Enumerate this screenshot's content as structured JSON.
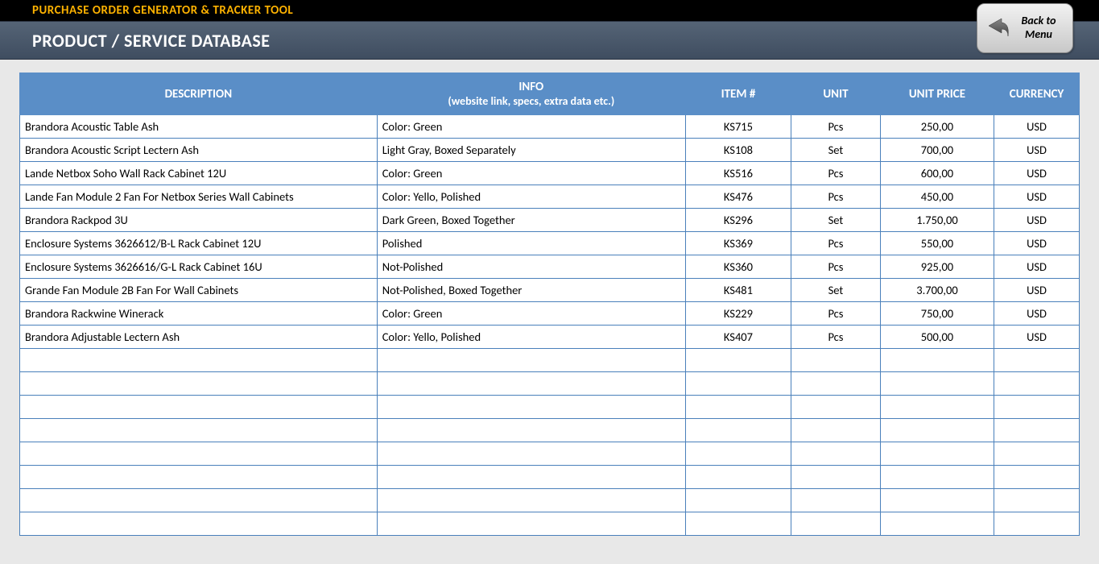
{
  "header": {
    "app_title": "PURCHASE ORDER GENERATOR & TRACKER TOOL",
    "page_title": "PRODUCT / SERVICE DATABASE",
    "back_button_line1": "Back to",
    "back_button_line2": "Menu"
  },
  "table": {
    "columns": {
      "description": "DESCRIPTION",
      "info": "INFO",
      "info_sub": "(website link, specs, extra data etc.)",
      "item": "ITEM #",
      "unit": "UNIT",
      "unit_price": "UNIT PRICE",
      "currency": "CURRENCY"
    },
    "rows": [
      {
        "description": "Brandora Acoustic Table Ash",
        "info": "Color: Green",
        "item": "KS715",
        "unit": "Pcs",
        "unit_price": "250,00",
        "currency": "USD"
      },
      {
        "description": "Brandora Acoustic Script Lectern Ash",
        "info": "Light Gray, Boxed Separately",
        "item": "KS108",
        "unit": "Set",
        "unit_price": "700,00",
        "currency": "USD"
      },
      {
        "description": "Lande Netbox Soho Wall Rack Cabinet 12U",
        "info": "Color: Green",
        "item": "KS516",
        "unit": "Pcs",
        "unit_price": "600,00",
        "currency": "USD"
      },
      {
        "description": "Lande Fan Module 2 Fan For Netbox Series Wall Cabinets",
        "info": "Color: Yello, Polished",
        "item": "KS476",
        "unit": "Pcs",
        "unit_price": "450,00",
        "currency": "USD"
      },
      {
        "description": "Brandora Rackpod 3U",
        "info": "Dark Green, Boxed Together",
        "item": "KS296",
        "unit": "Set",
        "unit_price": "1.750,00",
        "currency": "USD"
      },
      {
        "description": "Enclosure Systems 3626612/B-L Rack Cabinet 12U",
        "info": "Polished",
        "item": "KS369",
        "unit": "Pcs",
        "unit_price": "550,00",
        "currency": "USD"
      },
      {
        "description": "Enclosure Systems 3626616/G-L Rack Cabinet 16U",
        "info": "Not-Polished",
        "item": "KS360",
        "unit": "Pcs",
        "unit_price": "925,00",
        "currency": "USD"
      },
      {
        "description": "Grande Fan Module 2B Fan For Wall Cabinets",
        "info": "Not-Polished, Boxed Together",
        "item": "KS481",
        "unit": "Set",
        "unit_price": "3.700,00",
        "currency": "USD"
      },
      {
        "description": "Brandora Rackwine Winerack",
        "info": "Color: Green",
        "item": "KS229",
        "unit": "Pcs",
        "unit_price": "750,00",
        "currency": "USD"
      },
      {
        "description": "Brandora Adjustable Lectern Ash",
        "info": "Color: Yello, Polished",
        "item": "KS407",
        "unit": "Pcs",
        "unit_price": "500,00",
        "currency": "USD"
      }
    ],
    "empty_rows": 8
  }
}
